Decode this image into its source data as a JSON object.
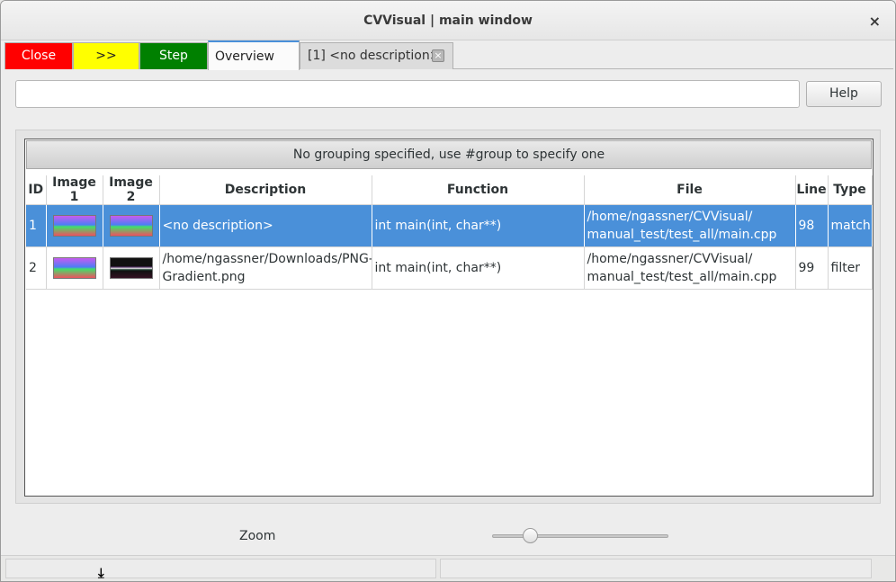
{
  "window": {
    "title": "CVVisual | main window",
    "close_glyph": "×"
  },
  "tabs": {
    "close": "Close",
    "next": ">>",
    "step": "Step",
    "overview": "Overview",
    "call": "[1] <no description>",
    "call_close_glyph": "×"
  },
  "filter": {
    "value": "",
    "placeholder": ""
  },
  "help_label": "Help",
  "group_header": "No grouping specified, use #group to specify one",
  "table": {
    "columns": [
      "ID",
      "Image 1",
      "Image 2",
      "Description",
      "Function",
      "File",
      "Line",
      "Type"
    ],
    "rows": [
      {
        "id": "1",
        "description": "<no description>",
        "function": "int main(int, char**)",
        "file": "/home/ngassner/CVVisual/ manual_test/test_all/main.cpp",
        "line": "98",
        "type": "match",
        "selected": true
      },
      {
        "id": "2",
        "description": "/home/ngassner/Downloads/PNG- Gradient.png",
        "function": "int main(int, char**)",
        "file": "/home/ngassner/CVVisual/ manual_test/test_all/main.cpp",
        "line": "99",
        "type": "filter",
        "selected": false
      }
    ]
  },
  "zoom": {
    "label": "Zoom",
    "value": 0.2
  },
  "colors": {
    "accent": "#4a90d9",
    "close_tab": "#ff0000",
    "next_tab": "#ffff00",
    "step_tab": "#008000"
  },
  "icons": {
    "window_close": "close-icon",
    "status_grip": "download-arrow-icon"
  },
  "status_glyph": "⤓"
}
